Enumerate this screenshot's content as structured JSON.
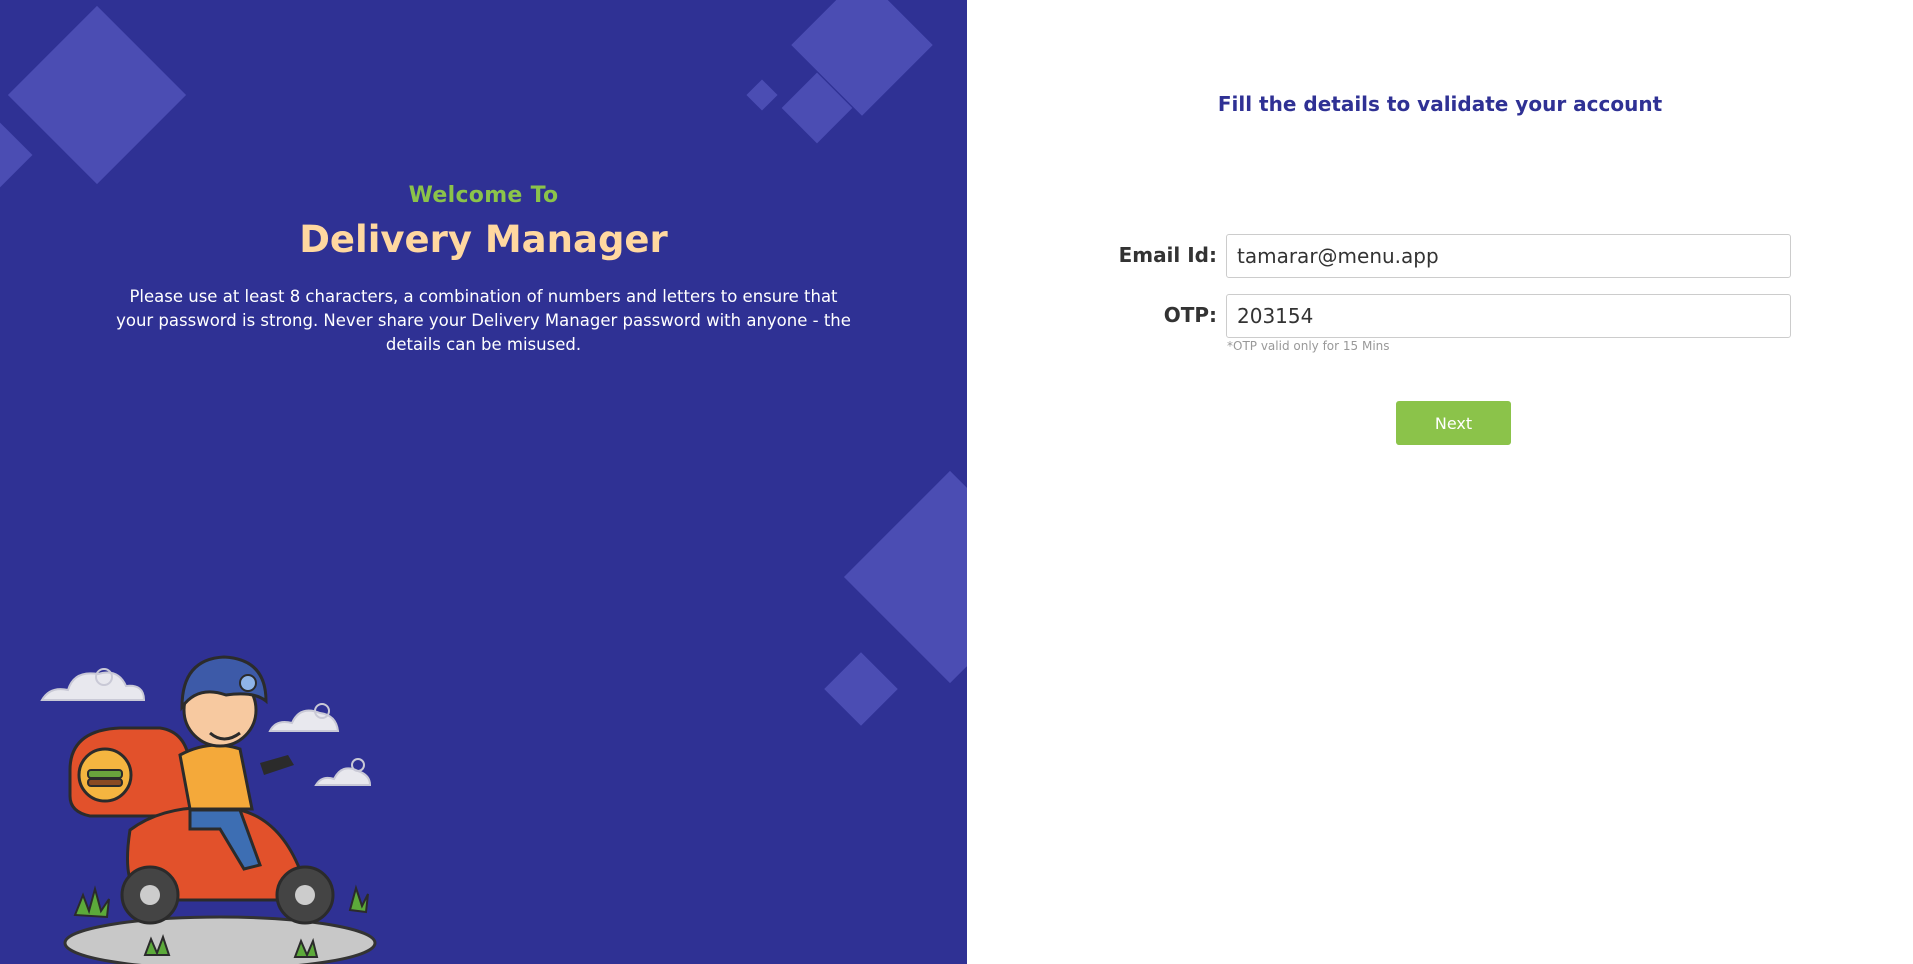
{
  "left": {
    "welcome": "Welcome To",
    "brand": "Delivery Manager",
    "info": "Please use at least 8 characters, a combination of numbers and letters to ensure that your password is strong. Never share your Delivery Manager password with anyone - the details can be misused.",
    "illustration": "delivery-scooter-rider-illustration"
  },
  "form": {
    "title": "Fill the details to validate your account",
    "email_label": "Email Id:",
    "email_value": "tamarar@menu.app",
    "otp_label": "OTP:",
    "otp_value": "203154",
    "otp_hint": "*OTP valid only for 15 Mins",
    "next_label": "Next"
  },
  "colors": {
    "panel_bg": "#2f3194",
    "diamond": "#4b4db3",
    "accent_green": "#8bc34a",
    "brand_peach": "#ffd8a0",
    "title_blue": "#2f3194"
  }
}
